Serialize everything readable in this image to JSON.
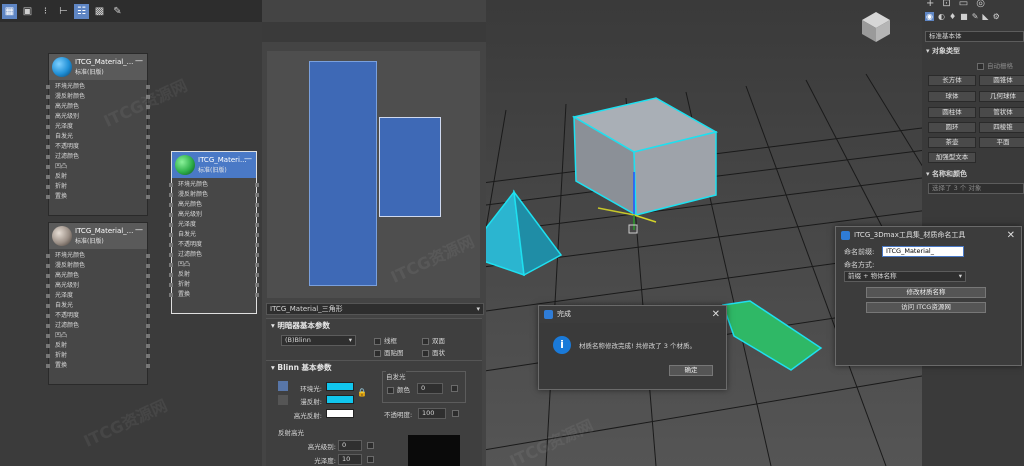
{
  "slate": {
    "nodes": [
      {
        "title": "ITCG_Material_...",
        "subtitle": "标准(旧版)",
        "color": "#1f8fd6",
        "slots": [
          "环境光颜色",
          "漫反射颜色",
          "高光颜色",
          "高光级别",
          "光泽度",
          "自发光",
          "不透明度",
          "过滤颜色",
          "凹凸",
          "反射",
          "折射",
          "置换"
        ]
      },
      {
        "title": "ITCG_Materi...",
        "subtitle": "标准(旧版)",
        "color": "#2fb04a",
        "slots": [
          "环境光颜色",
          "漫反射颜色",
          "高光颜色",
          "高光级别",
          "光泽度",
          "自发光",
          "不透明度",
          "过滤颜色",
          "凹凸",
          "反射",
          "折射",
          "置换"
        ]
      },
      {
        "title": "ITCG_Material_...",
        "subtitle": "标准(旧版)",
        "color": "#9b8f86",
        "slots": [
          "环境光颜色",
          "漫反射颜色",
          "高光颜色",
          "高光级别",
          "光泽度",
          "自发光",
          "不透明度",
          "过滤颜色",
          "凹凸",
          "反射",
          "折射",
          "置换"
        ]
      }
    ]
  },
  "material": {
    "name": "ITCG_Material_三角形",
    "shader_rollout": "明暗器基本参数",
    "shader": "(B)Blinn",
    "opts": [
      "线框",
      "双面",
      "面贴图",
      "面状"
    ],
    "blinn_rollout": "Blinn 基本参数",
    "self_illum": "自发光",
    "color_label": "颜色",
    "color_value": "0",
    "ambient": "环境光:",
    "diffuse": "漫反射:",
    "specular": "高光反射:",
    "opacity_label": "不透明度:",
    "opacity_value": "100",
    "reflect_hl": "反射高光",
    "spec_level": "高光级别:",
    "spec_level_value": "0",
    "glossiness": "光泽度:",
    "glossiness_value": "10"
  },
  "cmd": {
    "category": "标准基本体",
    "object_type": "对象类型",
    "autogrid": "自动栅格",
    "buttons": [
      "长方体",
      "圆锥体",
      "球体",
      "几何球体",
      "圆柱体",
      "管状体",
      "圆环",
      "四棱锥",
      "茶壶",
      "平面",
      "加强型文本"
    ],
    "name_color": "名称和颜色",
    "selected": "选择了 3 个 对象"
  },
  "rename_tool": {
    "title": "ITCG_3Dmax工具集_材质命名工具",
    "prefix_label": "命名前缀:",
    "prefix_value": "ITCG_Material_",
    "mode_label": "命名方式:",
    "mode_value": "前缀 + 物体名称",
    "modify_btn": "修改材质名称",
    "visit_btn": "访问 ITCG资源网"
  },
  "done_dialog": {
    "title": "完成",
    "message": "材质名称修改完成! 共修改了 3 个材质。",
    "ok": "确定"
  },
  "watermark": "ITCG资源网",
  "colors": {
    "accent": "#4a79c6",
    "cyan_sel": "#1ee0f0"
  }
}
